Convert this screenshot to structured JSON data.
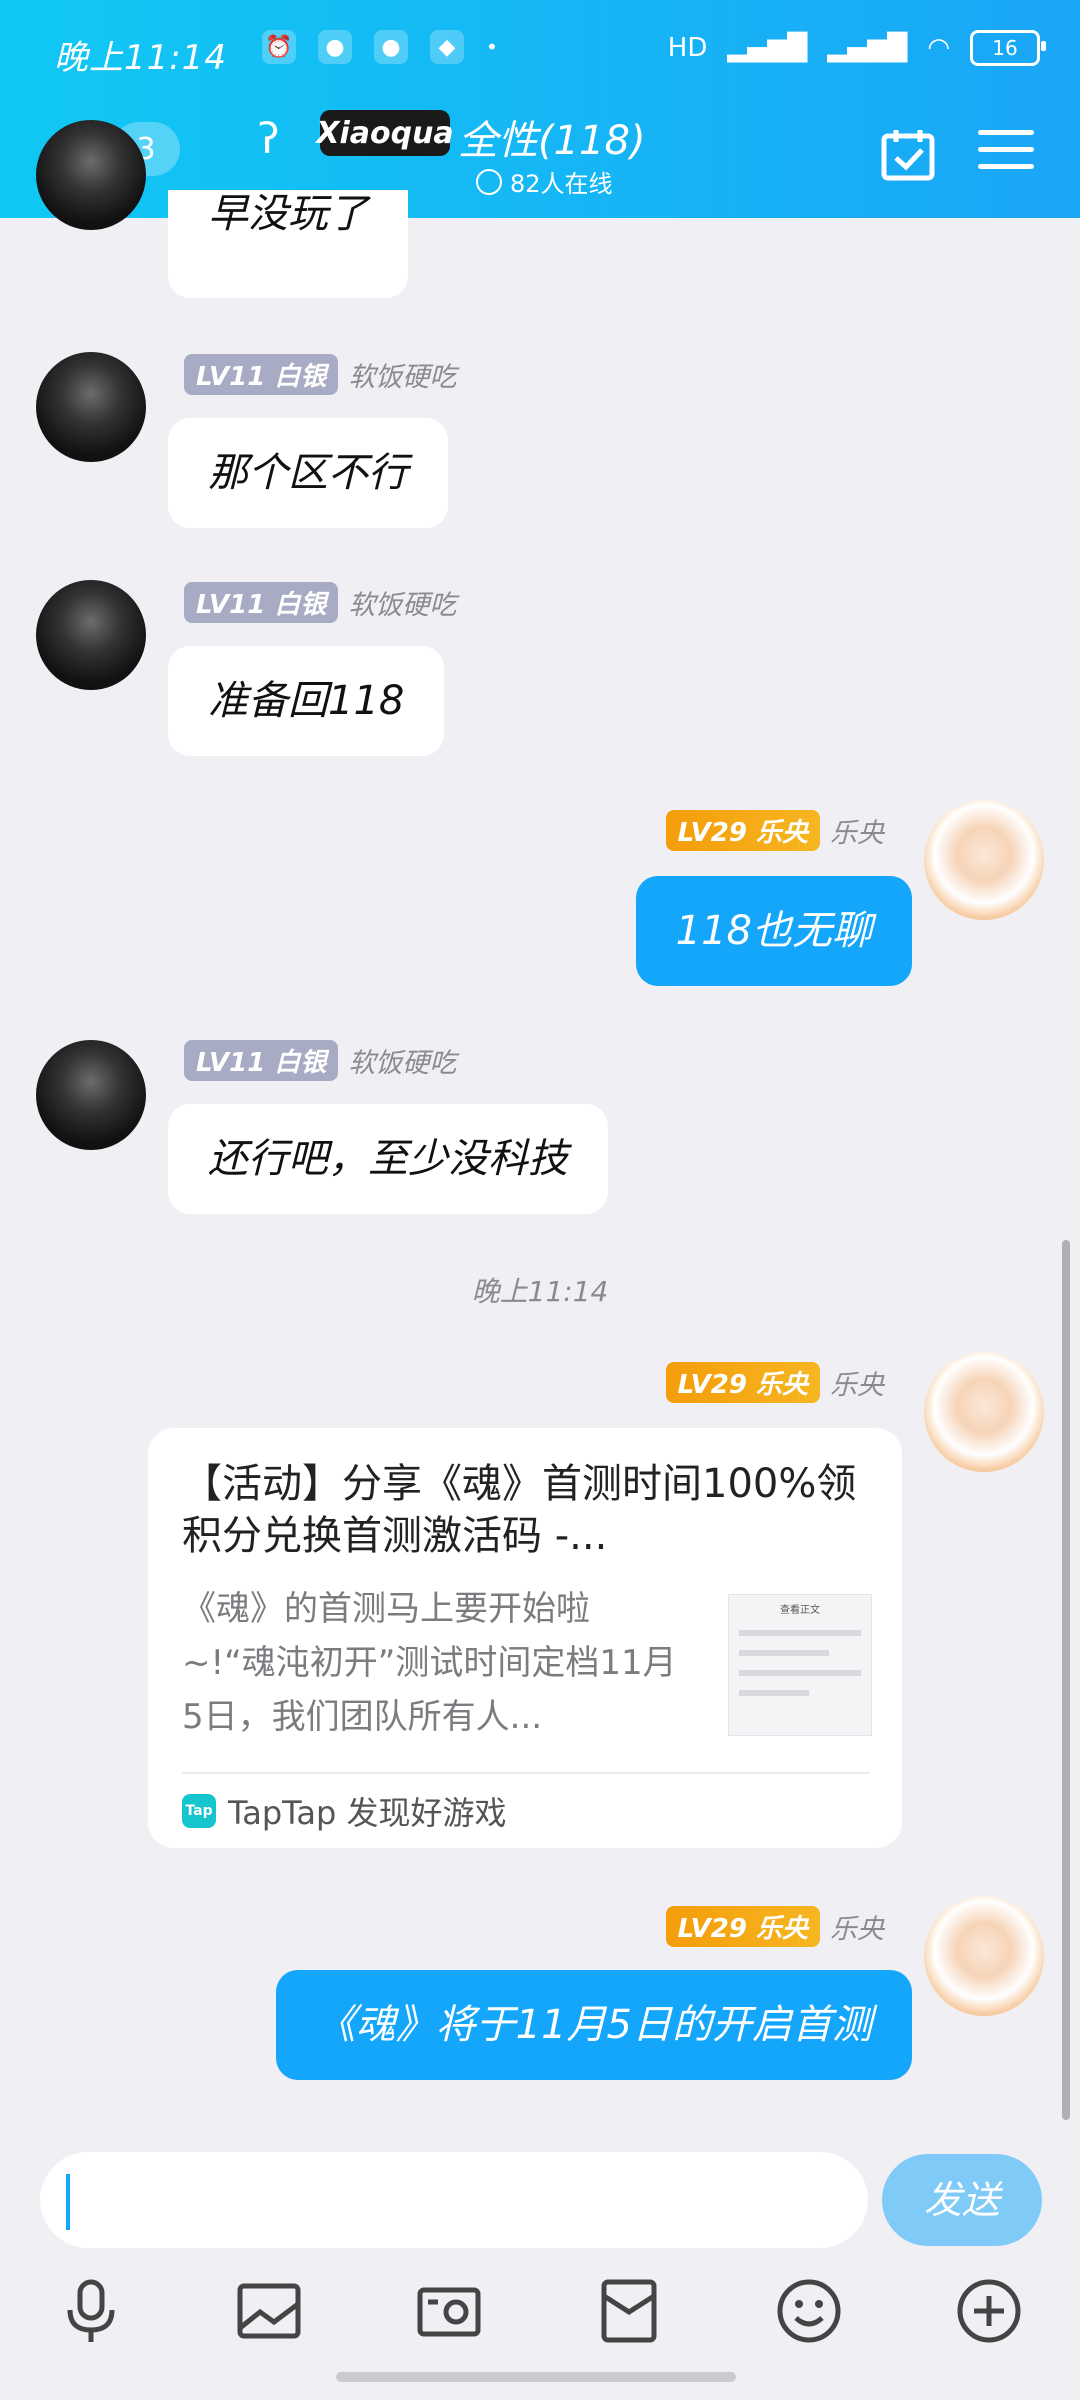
{
  "status_bar": {
    "time": "晚上11:14",
    "battery": "16",
    "network": "HD"
  },
  "header": {
    "back_count": "3",
    "logo_text": "Xiaoqua",
    "title": "全性(118)",
    "online": "82人在线"
  },
  "messages": {
    "m0": {
      "text": "早没玩了"
    },
    "m1": {
      "level": "LV11 白银",
      "nick": "软饭硬吃",
      "text": "那个区不行"
    },
    "m2": {
      "level": "LV11 白银",
      "nick": "软饭硬吃",
      "text": "准备回118"
    },
    "m3": {
      "level": "LV29 乐央",
      "nick": "乐央",
      "text": "118也无聊"
    },
    "m4": {
      "level": "LV11 白银",
      "nick": "软饭硬吃",
      "text": "还行吧，至少没科技"
    },
    "timestamp": "晚上11:14",
    "m5": {
      "level": "LV29 乐央",
      "nick": "乐央",
      "card_title": "【活动】分享《魂》首测时间100%领积分兑换首测激活码 -...",
      "card_desc": "《魂》的首测马上要开始啦~!“魂沌初开”测试时间定档11月5日，我们团队所有人...",
      "card_source": "TapTap 发现好游戏",
      "thumb_title": "查看正文"
    },
    "m6": {
      "level": "LV29 乐央",
      "nick": "乐央",
      "text": "《魂》将于11月5日的开启首测"
    }
  },
  "input": {
    "send_label": "发送"
  },
  "colors": {
    "accent": "#13a6fb",
    "header_gradient_start": "#10c8f4",
    "header_gradient_end": "#1aa6f6"
  }
}
